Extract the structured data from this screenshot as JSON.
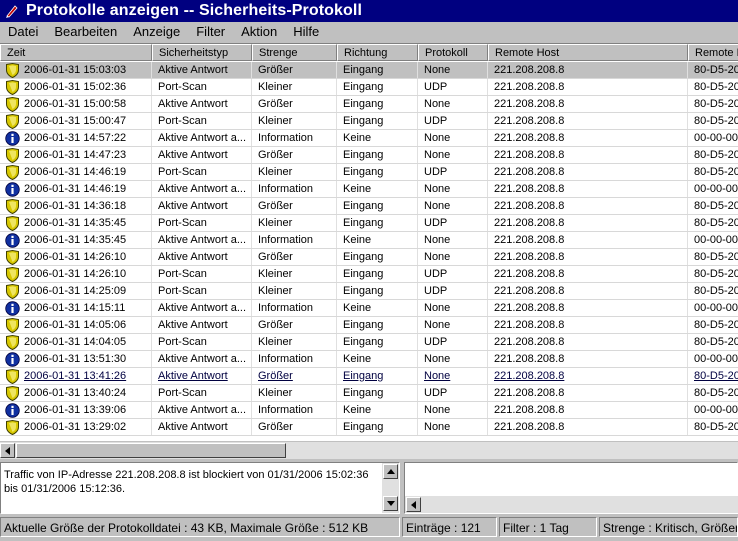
{
  "window": {
    "title": "Protokolle anzeigen -- Sicherheits-Protokoll"
  },
  "menu": [
    "Datei",
    "Bearbeiten",
    "Anzeige",
    "Filter",
    "Aktion",
    "Hilfe"
  ],
  "columns": [
    "Zeit",
    "Sicherheitstyp",
    "Strenge",
    "Richtung",
    "Protokoll",
    "Remote Host",
    "Remote M"
  ],
  "rows": [
    {
      "icon": "shield",
      "zeit": "2006-01-31 15:03:03",
      "typ": "Aktive Antwort",
      "strenge": "Größer",
      "richtung": "Eingang",
      "protokoll": "None",
      "host": "221.208.208.8",
      "mac": "80-D5-20",
      "selected": true
    },
    {
      "icon": "shield",
      "zeit": "2006-01-31 15:02:36",
      "typ": "Port-Scan",
      "strenge": "Kleiner",
      "richtung": "Eingang",
      "protokoll": "UDP",
      "host": "221.208.208.8",
      "mac": "80-D5-20"
    },
    {
      "icon": "shield",
      "zeit": "2006-01-31 15:00:58",
      "typ": "Aktive Antwort",
      "strenge": "Größer",
      "richtung": "Eingang",
      "protokoll": "None",
      "host": "221.208.208.8",
      "mac": "80-D5-20"
    },
    {
      "icon": "shield",
      "zeit": "2006-01-31 15:00:47",
      "typ": "Port-Scan",
      "strenge": "Kleiner",
      "richtung": "Eingang",
      "protokoll": "UDP",
      "host": "221.208.208.8",
      "mac": "80-D5-20"
    },
    {
      "icon": "info",
      "zeit": "2006-01-31 14:57:22",
      "typ": "Aktive Antwort a...",
      "strenge": "Information",
      "richtung": "Keine",
      "protokoll": "None",
      "host": "221.208.208.8",
      "mac": "00-00-00"
    },
    {
      "icon": "shield",
      "zeit": "2006-01-31 14:47:23",
      "typ": "Aktive Antwort",
      "strenge": "Größer",
      "richtung": "Eingang",
      "protokoll": "None",
      "host": "221.208.208.8",
      "mac": "80-D5-20"
    },
    {
      "icon": "shield",
      "zeit": "2006-01-31 14:46:19",
      "typ": "Port-Scan",
      "strenge": "Kleiner",
      "richtung": "Eingang",
      "protokoll": "UDP",
      "host": "221.208.208.8",
      "mac": "80-D5-20"
    },
    {
      "icon": "info",
      "zeit": "2006-01-31 14:46:19",
      "typ": "Aktive Antwort a...",
      "strenge": "Information",
      "richtung": "Keine",
      "protokoll": "None",
      "host": "221.208.208.8",
      "mac": "00-00-00"
    },
    {
      "icon": "shield",
      "zeit": "2006-01-31 14:36:18",
      "typ": "Aktive Antwort",
      "strenge": "Größer",
      "richtung": "Eingang",
      "protokoll": "None",
      "host": "221.208.208.8",
      "mac": "80-D5-20"
    },
    {
      "icon": "shield",
      "zeit": "2006-01-31 14:35:45",
      "typ": "Port-Scan",
      "strenge": "Kleiner",
      "richtung": "Eingang",
      "protokoll": "UDP",
      "host": "221.208.208.8",
      "mac": "80-D5-20"
    },
    {
      "icon": "info",
      "zeit": "2006-01-31 14:35:45",
      "typ": "Aktive Antwort a...",
      "strenge": "Information",
      "richtung": "Keine",
      "protokoll": "None",
      "host": "221.208.208.8",
      "mac": "00-00-00"
    },
    {
      "icon": "shield",
      "zeit": "2006-01-31 14:26:10",
      "typ": "Aktive Antwort",
      "strenge": "Größer",
      "richtung": "Eingang",
      "protokoll": "None",
      "host": "221.208.208.8",
      "mac": "80-D5-20"
    },
    {
      "icon": "shield",
      "zeit": "2006-01-31 14:26:10",
      "typ": "Port-Scan",
      "strenge": "Kleiner",
      "richtung": "Eingang",
      "protokoll": "UDP",
      "host": "221.208.208.8",
      "mac": "80-D5-20"
    },
    {
      "icon": "shield",
      "zeit": "2006-01-31 14:25:09",
      "typ": "Port-Scan",
      "strenge": "Kleiner",
      "richtung": "Eingang",
      "protokoll": "UDP",
      "host": "221.208.208.8",
      "mac": "80-D5-20"
    },
    {
      "icon": "info",
      "zeit": "2006-01-31 14:15:11",
      "typ": "Aktive Antwort a...",
      "strenge": "Information",
      "richtung": "Keine",
      "protokoll": "None",
      "host": "221.208.208.8",
      "mac": "00-00-00"
    },
    {
      "icon": "shield",
      "zeit": "2006-01-31 14:05:06",
      "typ": "Aktive Antwort",
      "strenge": "Größer",
      "richtung": "Eingang",
      "protokoll": "None",
      "host": "221.208.208.8",
      "mac": "80-D5-20"
    },
    {
      "icon": "shield",
      "zeit": "2006-01-31 14:04:05",
      "typ": "Port-Scan",
      "strenge": "Kleiner",
      "richtung": "Eingang",
      "protokoll": "UDP",
      "host": "221.208.208.8",
      "mac": "80-D5-20"
    },
    {
      "icon": "info",
      "zeit": "2006-01-31 13:51:30",
      "typ": "Aktive Antwort a...",
      "strenge": "Information",
      "richtung": "Keine",
      "protokoll": "None",
      "host": "221.208.208.8",
      "mac": "00-00-00"
    },
    {
      "icon": "shield",
      "zeit": "2006-01-31 13:41:26",
      "typ": "Aktive Antwort",
      "strenge": "Größer",
      "richtung": "Eingang",
      "protokoll": "None",
      "host": "221.208.208.8",
      "mac": "80-D5-20",
      "underlined": true
    },
    {
      "icon": "shield",
      "zeit": "2006-01-31 13:40:24",
      "typ": "Port-Scan",
      "strenge": "Kleiner",
      "richtung": "Eingang",
      "protokoll": "UDP",
      "host": "221.208.208.8",
      "mac": "80-D5-20"
    },
    {
      "icon": "info",
      "zeit": "2006-01-31 13:39:06",
      "typ": "Aktive Antwort a...",
      "strenge": "Information",
      "richtung": "Keine",
      "protokoll": "None",
      "host": "221.208.208.8",
      "mac": "00-00-00"
    },
    {
      "icon": "shield",
      "zeit": "2006-01-31 13:29:02",
      "typ": "Aktive Antwort",
      "strenge": "Größer",
      "richtung": "Eingang",
      "protokoll": "None",
      "host": "221.208.208.8",
      "mac": "80-D5-20"
    }
  ],
  "details": {
    "text": "Traffic von IP-Adresse 221.208.208.8 ist blockiert von 01/31/2006 15:02:36 bis 01/31/2006 15:12:36."
  },
  "status": {
    "size": "Aktuelle Größe der Protokolldatei :  43 KB, Maximale Größe : 512 KB",
    "entries": "Einträge : 121",
    "filter": "Filter : 1 Tag",
    "strenge": "Strenge : Kritisch, Größer"
  },
  "colors": {
    "titlebar": "#000080",
    "shield": "#d8c800",
    "info": "#1030a0",
    "face": "#c0c0c0"
  },
  "icons": {
    "app": "pen-icon",
    "shield": "shield-icon",
    "info": "info-icon"
  }
}
